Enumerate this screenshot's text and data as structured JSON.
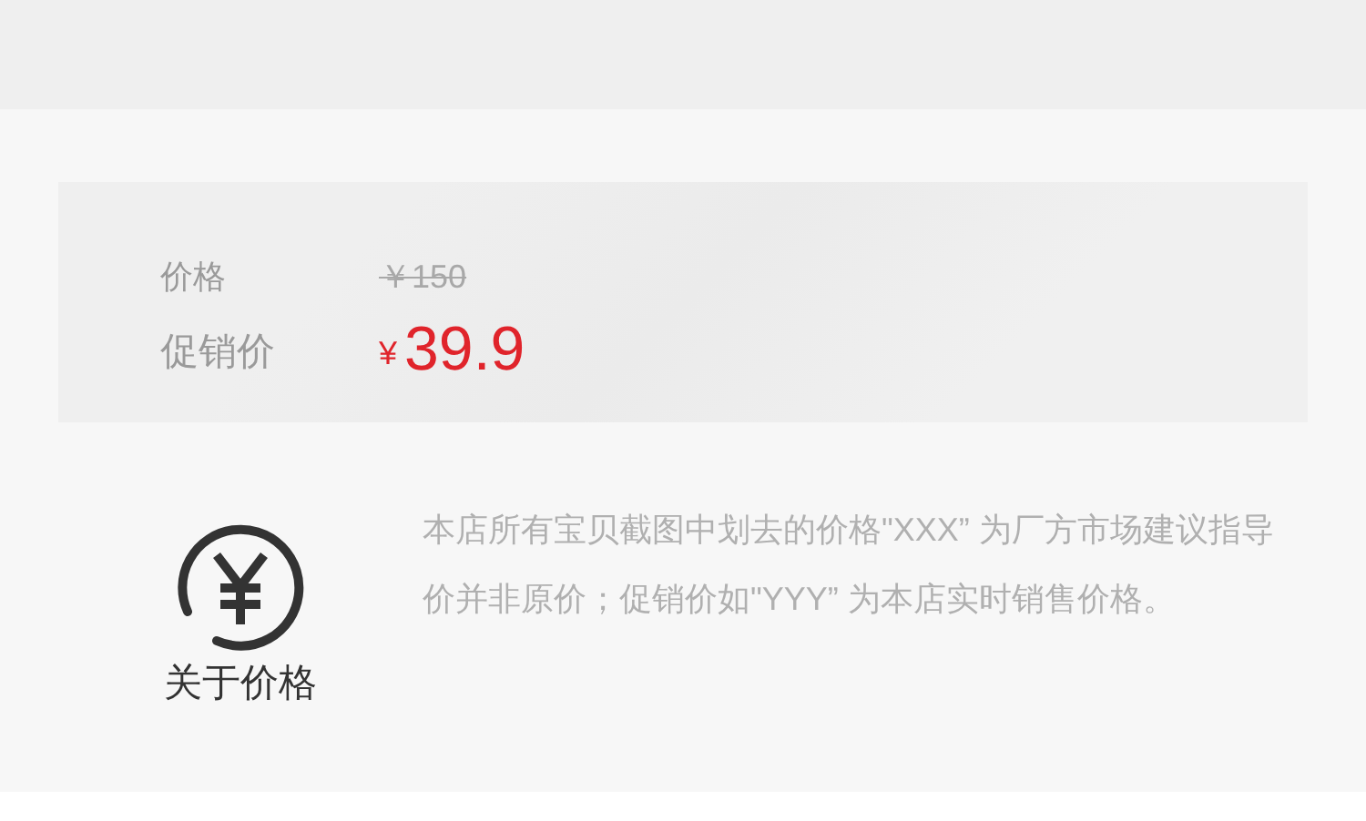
{
  "price_card": {
    "original_label": "价格",
    "original_price": "￥150",
    "promo_label": "促销价",
    "currency": "¥",
    "promo_price": "39.9"
  },
  "about_price": {
    "title": "关于价格",
    "description": "本店所有宝贝截图中划去的价格\"XXX” 为厂方市场建议指导价并非原价；促销价如\"YYY” 为本店实时销售价格。"
  }
}
